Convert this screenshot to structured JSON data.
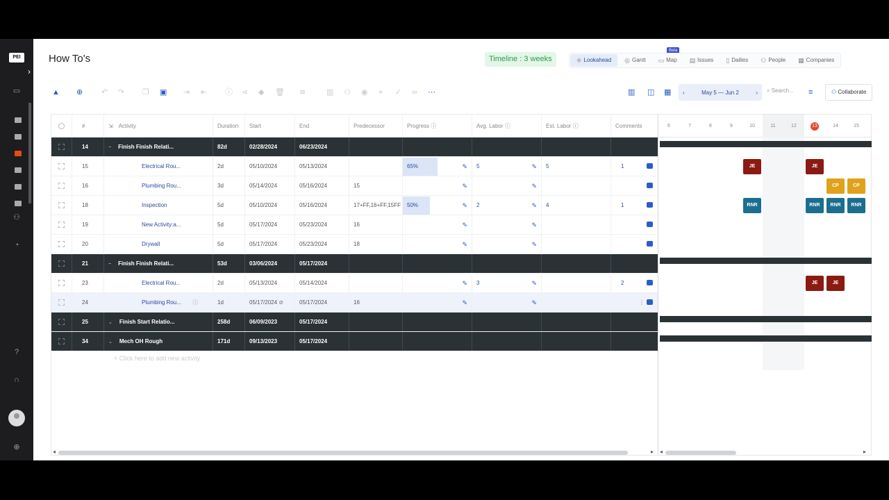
{
  "app": {
    "logo": "PEI",
    "page_title": "How To's",
    "timeline_badge": "Timeline : 3 weeks"
  },
  "views": [
    {
      "label": "Lookahead",
      "active": true
    },
    {
      "label": "Gantt"
    },
    {
      "label": "Map",
      "badge": "Beta"
    },
    {
      "label": "Issues"
    },
    {
      "label": "Dailies"
    },
    {
      "label": "People"
    },
    {
      "label": "Companies"
    }
  ],
  "toolbar": {
    "date_range": "May 5 — Jun 2",
    "search_placeholder": "Search...",
    "collaborate": "Collaborate"
  },
  "columns": [
    "#",
    "Activity",
    "Duration",
    "Start",
    "End",
    "Predecessor",
    "Progress",
    "Avg. Labor",
    "Est. Labor",
    "Comments"
  ],
  "rows": [
    {
      "type": "group",
      "num": "14",
      "activity": "Finish Finish Relati...",
      "duration": "82d",
      "start": "02/28/2024",
      "end": "06/23/2024",
      "pred": "",
      "progress": "",
      "avg": "",
      "est": "",
      "comments": ""
    },
    {
      "type": "sub",
      "num": "15",
      "activity": "Electrical Rou...",
      "duration": "2d",
      "start": "05/10/2024",
      "end": "05/13/2024",
      "pred": "",
      "progress": "65%",
      "progress_frac": 0.65,
      "avg": "5",
      "est": "5",
      "comments": "1"
    },
    {
      "type": "sub",
      "num": "16",
      "activity": "Plumbing Rou...",
      "duration": "3d",
      "start": "05/14/2024",
      "end": "05/16/2024",
      "pred": "15",
      "progress": "",
      "avg": "",
      "est": "",
      "comments": ""
    },
    {
      "type": "sub",
      "num": "18",
      "activity": "Inspection",
      "duration": "5d",
      "start": "05/10/2024",
      "end": "05/16/2024",
      "pred": "17+FF,16+FF,15FF",
      "progress": "50%",
      "progress_frac": 0.5,
      "avg": "2",
      "est": "4",
      "comments": "1"
    },
    {
      "type": "sub",
      "num": "19",
      "activity": "New Activity:a...",
      "duration": "5d",
      "start": "05/17/2024",
      "end": "05/23/2024",
      "pred": "16",
      "progress": "",
      "avg": "",
      "est": "",
      "comments": ""
    },
    {
      "type": "sub",
      "num": "20",
      "activity": "Drywall",
      "duration": "5d",
      "start": "05/17/2024",
      "end": "05/23/2024",
      "pred": "18",
      "progress": "",
      "avg": "",
      "est": "",
      "comments": ""
    },
    {
      "type": "group",
      "num": "21",
      "activity": "Finish Finish Relati...",
      "duration": "53d",
      "start": "03/06/2024",
      "end": "05/17/2024",
      "pred": "",
      "progress": "",
      "avg": "",
      "est": "",
      "comments": ""
    },
    {
      "type": "sub",
      "num": "23",
      "activity": "Electrical Rou...",
      "duration": "2d",
      "start": "05/13/2024",
      "end": "05/14/2024",
      "pred": "",
      "progress": "",
      "avg": "3",
      "est": "",
      "comments": "2"
    },
    {
      "type": "sub",
      "num": "24",
      "activity": "Plumbing Rou...",
      "duration": "1d",
      "start": "05/17/2024",
      "end": "05/17/2024",
      "pred": "16",
      "progress": "",
      "avg": "",
      "est": "",
      "comments": "",
      "highlight": true
    },
    {
      "type": "group",
      "num": "25",
      "activity": "Finish Start Relatio...",
      "duration": "258d",
      "start": "06/09/2023",
      "end": "05/17/2024",
      "pred": "",
      "progress": "",
      "avg": "",
      "est": "",
      "comments": ""
    },
    {
      "type": "group",
      "num": "34",
      "activity": "Mech OH Rough",
      "duration": "171d",
      "start": "09/13/2023",
      "end": "05/17/2024",
      "pred": "",
      "progress": "",
      "avg": "",
      "est": "",
      "comments": ""
    }
  ],
  "add_activity": "+ Click here to add new activity",
  "gantt": {
    "days": [
      "6",
      "7",
      "8",
      "9",
      "10",
      "11",
      "12",
      "13",
      "14",
      "15"
    ],
    "today": "13",
    "weekend": [
      "11",
      "12"
    ],
    "tasks": [
      {
        "row": 1,
        "day": "10",
        "label": "JE",
        "kind": "je"
      },
      {
        "row": 1,
        "day": "13",
        "label": "JE",
        "kind": "je"
      },
      {
        "row": 2,
        "day": "14",
        "label": "CP",
        "kind": "cp"
      },
      {
        "row": 2,
        "day": "15",
        "label": "CP",
        "kind": "cp"
      },
      {
        "row": 3,
        "day": "10",
        "label": "RNR",
        "kind": "rnr"
      },
      {
        "row": 3,
        "day": "13",
        "label": "RNR",
        "kind": "rnr"
      },
      {
        "row": 3,
        "day": "14",
        "label": "RNR",
        "kind": "rnr"
      },
      {
        "row": 3,
        "day": "15",
        "label": "RNR",
        "kind": "rnr"
      },
      {
        "row": 7,
        "day": "13",
        "label": "JE",
        "kind": "je"
      },
      {
        "row": 7,
        "day": "14",
        "label": "JE",
        "kind": "je"
      }
    ]
  }
}
